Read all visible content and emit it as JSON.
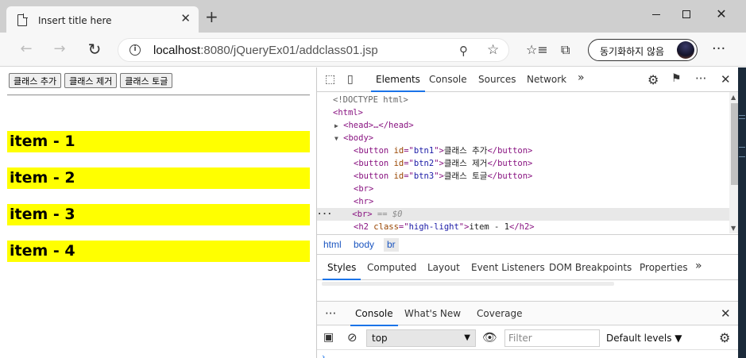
{
  "browser": {
    "tab_title": "Insert title here",
    "tab_close": "✕",
    "new_tab": "+",
    "url_host": "localhost",
    "url_rest": ":8080/jQueryEx01/addclass01.jsp",
    "sync_label": "동기화하지 않음",
    "icons": [
      "doc-icon",
      "back-icon",
      "forward-icon",
      "reload-icon",
      "info-icon",
      "zoom-icon",
      "star-icon",
      "favorites-icon",
      "collections-icon",
      "more-icon"
    ]
  },
  "page": {
    "buttons": [
      "클래스 추가",
      "클래스 제거",
      "클래스 토글"
    ],
    "items": [
      "item - 1",
      "item - 2",
      "item - 3",
      "item - 4"
    ],
    "highlight_color": "#ffff00"
  },
  "devtools": {
    "tabs": [
      "Elements",
      "Console",
      "Sources",
      "Network"
    ],
    "more": "»",
    "elements": {
      "doctype": "<!DOCTYPE html>",
      "html_open": "<html>",
      "head": "<head>…</head>",
      "body_open": "<body>",
      "buttons": [
        {
          "id": "btn1",
          "text": "클래스 추가"
        },
        {
          "id": "btn2",
          "text": "클래스 제거"
        },
        {
          "id": "btn3",
          "text": "클래스 토글"
        }
      ],
      "br1": "<br>",
      "hr": "<hr>",
      "br2": "<br>",
      "selected_marker": "== $0",
      "h2_class": "high-light",
      "h2_text": "item - 1",
      "dots": "···"
    },
    "breadcrumbs": [
      "html",
      "body",
      "br"
    ],
    "styles_tabs": [
      "Styles",
      "Computed",
      "Layout",
      "Event Listeners",
      "DOM Breakpoints",
      "Properties"
    ],
    "drawer_tabs": [
      "Console",
      "What's New",
      "Coverage"
    ],
    "console": {
      "context": "top",
      "filter_placeholder": "Filter",
      "levels": "Default levels ▼"
    }
  }
}
